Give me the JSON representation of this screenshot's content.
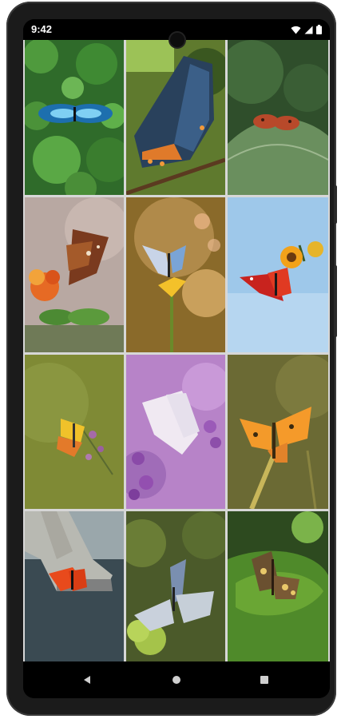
{
  "status_bar": {
    "time": "9:42"
  },
  "icons": {
    "wifi": "wifi-icon",
    "signal": "signal-icon",
    "battery": "battery-icon",
    "back": "back-icon",
    "home": "home-icon",
    "recents": "recents-icon"
  },
  "gallery": {
    "tiles": [
      {
        "subject": "blue-morpho-on-leaves"
      },
      {
        "subject": "red-spotted-purple-on-twig"
      },
      {
        "subject": "small-orange-on-leaf"
      },
      {
        "subject": "brown-butterfly-on-flowers"
      },
      {
        "subject": "blue-butterfly-on-yellow-flower"
      },
      {
        "subject": "red-admiral-on-sunflower"
      },
      {
        "subject": "orange-tip-on-stem"
      },
      {
        "subject": "white-butterfly-on-purple-flowers"
      },
      {
        "subject": "orange-butterfly-on-grass"
      },
      {
        "subject": "monarch-by-shoe"
      },
      {
        "subject": "blue-butterfly-on-plant"
      },
      {
        "subject": "speckled-wood-on-leaf"
      }
    ]
  }
}
